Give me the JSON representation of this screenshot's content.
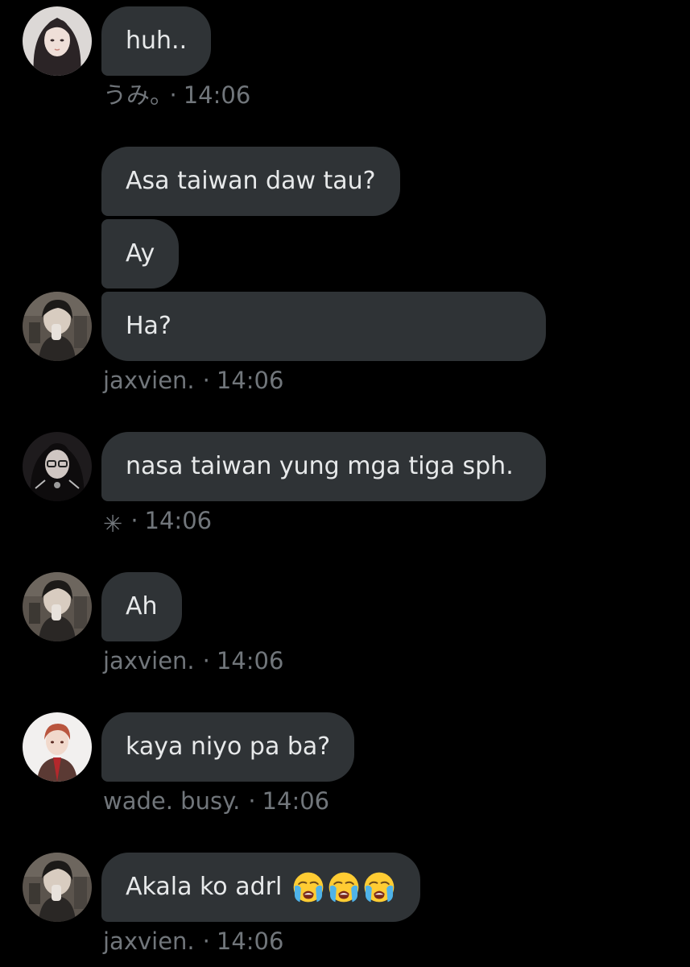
{
  "messages": [
    {
      "sender": "うみ。",
      "time": "14:06",
      "separator": "·",
      "avatar_icon": "avatar-girl-dark-hair",
      "bubbles": [
        "huh.."
      ]
    },
    {
      "sender": "jaxvien.",
      "time": "14:06",
      "separator": "·",
      "avatar_icon": "avatar-boy-dark-hair",
      "bubbles": [
        "Asa taiwan daw tau?",
        "Ay",
        "Ha?"
      ]
    },
    {
      "sender": "✳",
      "time": "14:06",
      "separator": "·",
      "avatar_icon": "avatar-girl-glasses",
      "bubbles": [
        "nasa taiwan yung mga tiga sph."
      ]
    },
    {
      "sender": "jaxvien.",
      "time": "14:06",
      "separator": "·",
      "avatar_icon": "avatar-boy-dark-hair",
      "bubbles": [
        "Ah"
      ]
    },
    {
      "sender": "wade. busy.",
      "time": "14:06",
      "separator": "·",
      "avatar_icon": "avatar-anime-red-hair",
      "bubbles": [
        "kaya niyo pa ba?"
      ]
    },
    {
      "sender": "jaxvien.",
      "time": "14:06",
      "separator": "·",
      "avatar_icon": "avatar-boy-dark-hair",
      "bubbles": [
        "Akala ko adrl"
      ],
      "emojis": [
        "loudly-crying-face-icon",
        "loudly-crying-face-icon",
        "loudly-crying-face-icon"
      ]
    }
  ],
  "colors": {
    "background": "#000000",
    "bubble": "#2f3336",
    "text": "#e7e9ea",
    "meta": "#71767b"
  }
}
